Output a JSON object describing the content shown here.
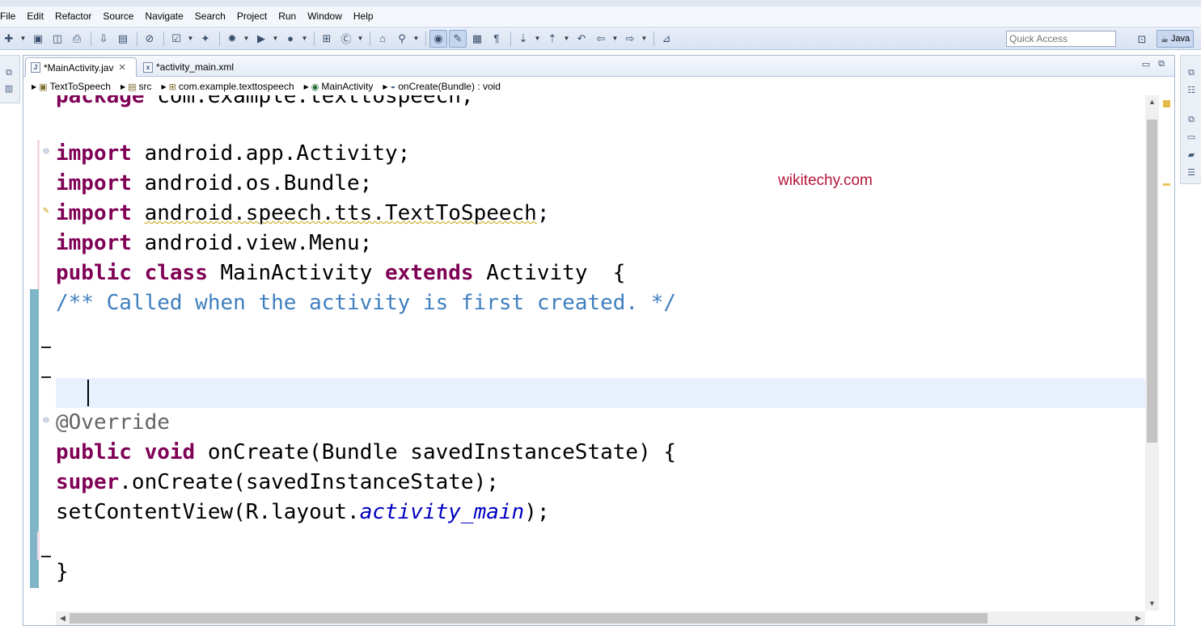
{
  "menu": [
    "File",
    "Edit",
    "Refactor",
    "Source",
    "Navigate",
    "Search",
    "Project",
    "Run",
    "Window",
    "Help"
  ],
  "toolbar": {
    "quick_access_placeholder": "Quick Access",
    "perspective_label": "Java"
  },
  "tabs": [
    {
      "label": "*MainActivity.jav",
      "active": true
    },
    {
      "label": "*activity_main.xml",
      "active": false
    }
  ],
  "breadcrumb": [
    "TextToSpeech",
    "src",
    "com.example.texttospeech",
    "MainActivity",
    "onCreate(Bundle) : void"
  ],
  "code": {
    "l0": [
      "package",
      " com.example.texttospeech;"
    ],
    "l1": [
      "import",
      " android.app.Activity;"
    ],
    "l2": [
      "import",
      " android.os.Bundle;"
    ],
    "l3": [
      "import",
      " ",
      "android.speech.tts.TextToSpeech",
      ";"
    ],
    "l4": [
      "import",
      " android.view.Menu;"
    ],
    "l5": [
      "public",
      " ",
      "class",
      " MainActivity ",
      "extends",
      " Activity  {"
    ],
    "l6": "/** Called when the activity is first created. */",
    "l7": "@Override",
    "l8": [
      "public",
      " ",
      "void",
      " onCreate(Bundle savedInstanceState) {"
    ],
    "l9": [
      "super",
      ".onCreate(savedInstanceState);"
    ],
    "l10": [
      "setContentView(R.layout.",
      "activity_main",
      ");"
    ],
    "l11": "}"
  },
  "watermark": "wikitechy.com",
  "colors": {
    "keyword": "#7f0055",
    "comment": "#3f7fbf",
    "annotation": "#646464",
    "field": "#0000c0",
    "watermark": "#b5163a",
    "current_line": "#e8f2fe"
  }
}
